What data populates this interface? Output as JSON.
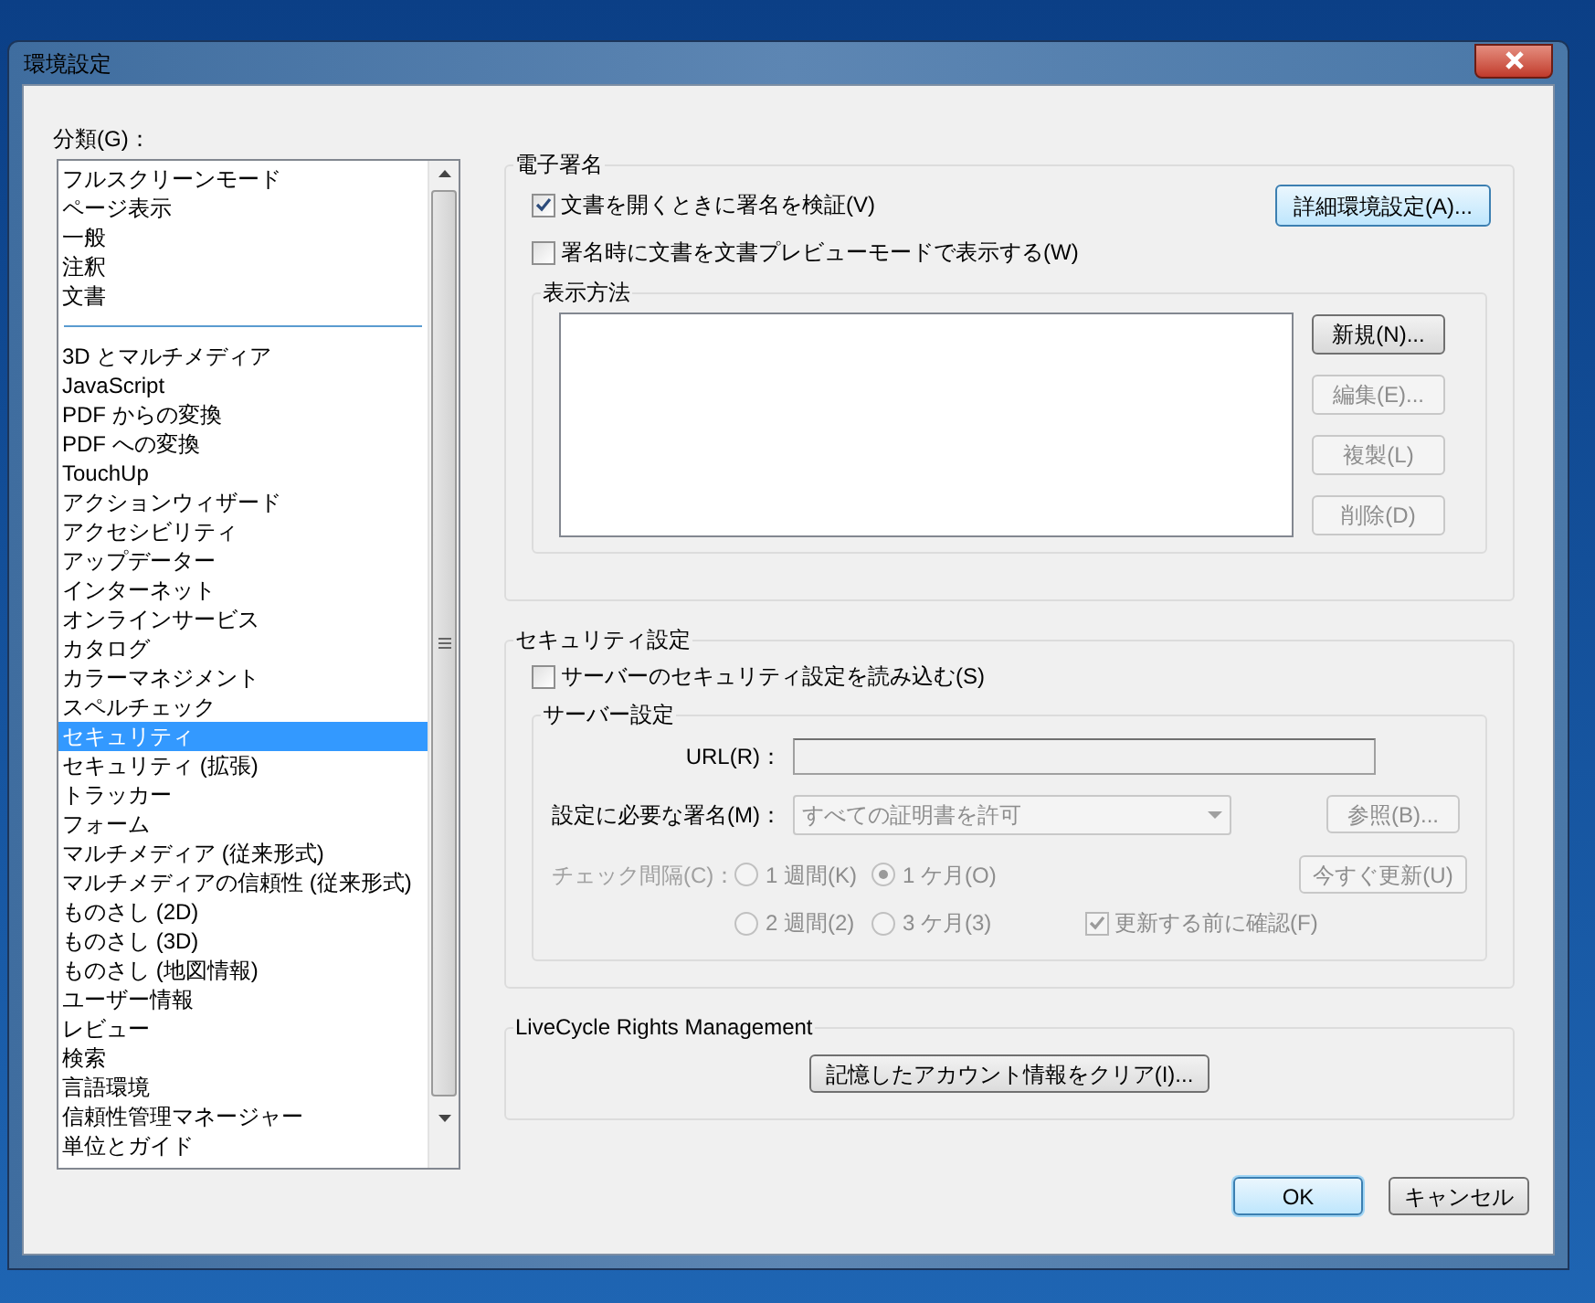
{
  "window": {
    "title": "環境設定"
  },
  "categories": {
    "label": "分類(G)：",
    "groups": [
      {
        "items": [
          {
            "label": "フルスクリーンモード",
            "selected": false
          },
          {
            "label": "ページ表示",
            "selected": false
          },
          {
            "label": "一般",
            "selected": false
          },
          {
            "label": "注釈",
            "selected": false
          },
          {
            "label": "文書",
            "selected": false
          }
        ]
      },
      {
        "items": [
          {
            "label": "3D とマルチメディア",
            "selected": false
          },
          {
            "label": "JavaScript",
            "selected": false
          },
          {
            "label": "PDF からの変換",
            "selected": false
          },
          {
            "label": "PDF への変換",
            "selected": false
          },
          {
            "label": "TouchUp",
            "selected": false
          },
          {
            "label": "アクションウィザード",
            "selected": false
          },
          {
            "label": "アクセシビリティ",
            "selected": false
          },
          {
            "label": "アップデーター",
            "selected": false
          },
          {
            "label": "インターネット",
            "selected": false
          },
          {
            "label": "オンラインサービス",
            "selected": false
          },
          {
            "label": "カタログ",
            "selected": false
          },
          {
            "label": "カラーマネジメント",
            "selected": false
          },
          {
            "label": "スペルチェック",
            "selected": false
          },
          {
            "label": "セキュリティ",
            "selected": true
          },
          {
            "label": "セキュリティ (拡張)",
            "selected": false
          },
          {
            "label": "トラッカー",
            "selected": false
          },
          {
            "label": "フォーム",
            "selected": false
          },
          {
            "label": "マルチメディア (従来形式)",
            "selected": false
          },
          {
            "label": "マルチメディアの信頼性 (従来形式)",
            "selected": false
          },
          {
            "label": "ものさし (2D)",
            "selected": false
          },
          {
            "label": "ものさし (3D)",
            "selected": false
          },
          {
            "label": "ものさし (地図情報)",
            "selected": false
          },
          {
            "label": "ユーザー情報",
            "selected": false
          },
          {
            "label": "レビュー",
            "selected": false
          },
          {
            "label": "検索",
            "selected": false
          },
          {
            "label": "言語環境",
            "selected": false
          },
          {
            "label": "信頼性管理マネージャー",
            "selected": false
          },
          {
            "label": "単位とガイド",
            "selected": false
          }
        ]
      }
    ]
  },
  "digital_signatures": {
    "title": "電子署名",
    "options": [
      {
        "label": "文書を開くときに署名を検証(V)",
        "checked": true
      },
      {
        "label": "署名時に文書を文書プレビューモードで表示する(W)",
        "checked": false
      }
    ],
    "advanced_button": "詳細環境設定(A)...",
    "appearance": {
      "title": "表示方法",
      "buttons": [
        {
          "label": "新規(N)...",
          "disabled": false
        },
        {
          "label": "編集(E)...",
          "disabled": true
        },
        {
          "label": "複製(L)",
          "disabled": true
        },
        {
          "label": "削除(D)",
          "disabled": true
        }
      ]
    }
  },
  "security_settings": {
    "title": "セキュリティ設定",
    "load_option": {
      "label": "サーバーのセキュリティ設定を読み込む(S)",
      "checked": false
    },
    "server": {
      "title": "サーバー設定",
      "url_label": "URL(R)：",
      "signature_label": "設定に必要な署名(M)：",
      "signature_select": {
        "value": "すべての証明書を許可",
        "disabled": true
      },
      "browse_button": {
        "label": "参照(B)...",
        "disabled": true
      },
      "interval_label": {
        "text": "チェック間隔(C)：",
        "disabled": true
      },
      "intervals": [
        {
          "label": "1 週間(K)",
          "selected": false,
          "disabled": true
        },
        {
          "label": "1 ケ月(O)",
          "selected": true,
          "disabled": true
        },
        {
          "label": "2 週間(2)",
          "selected": false,
          "disabled": true
        },
        {
          "label": "3 ケ月(3)",
          "selected": false,
          "disabled": true
        }
      ],
      "update_button": {
        "label": "今すぐ更新(U)",
        "disabled": true
      },
      "confirm_option": {
        "label": "更新する前に確認(F)",
        "checked": true,
        "disabled": true
      }
    }
  },
  "livecycle": {
    "title": "LiveCycle Rights Management",
    "clear_button": "記憶したアカウント情報をクリア(I)..."
  },
  "footer_buttons": [
    {
      "label": "OK",
      "default": true
    },
    {
      "label": "キャンセル",
      "default": false
    }
  ]
}
